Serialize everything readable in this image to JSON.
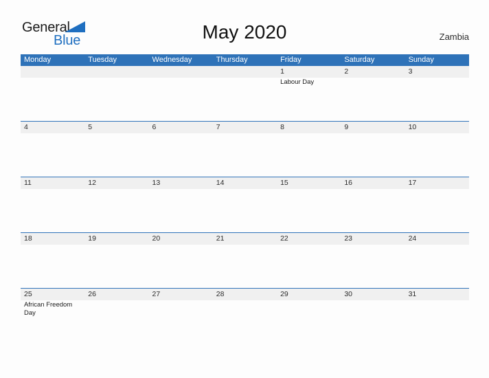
{
  "brand": {
    "name_part1": "General",
    "name_part2": "Blue",
    "accent_color": "#1f6fc0"
  },
  "header": {
    "title": "May 2020",
    "country": "Zambia"
  },
  "calendar": {
    "header_color": "#2e72b8",
    "band_color": "#f0f0f0",
    "day_names": [
      "Monday",
      "Tuesday",
      "Wednesday",
      "Thursday",
      "Friday",
      "Saturday",
      "Sunday"
    ],
    "weeks": [
      [
        {
          "day": "",
          "events": []
        },
        {
          "day": "",
          "events": []
        },
        {
          "day": "",
          "events": []
        },
        {
          "day": "",
          "events": []
        },
        {
          "day": "1",
          "events": [
            "Labour Day"
          ]
        },
        {
          "day": "2",
          "events": []
        },
        {
          "day": "3",
          "events": []
        }
      ],
      [
        {
          "day": "4",
          "events": []
        },
        {
          "day": "5",
          "events": []
        },
        {
          "day": "6",
          "events": []
        },
        {
          "day": "7",
          "events": []
        },
        {
          "day": "8",
          "events": []
        },
        {
          "day": "9",
          "events": []
        },
        {
          "day": "10",
          "events": []
        }
      ],
      [
        {
          "day": "11",
          "events": []
        },
        {
          "day": "12",
          "events": []
        },
        {
          "day": "13",
          "events": []
        },
        {
          "day": "14",
          "events": []
        },
        {
          "day": "15",
          "events": []
        },
        {
          "day": "16",
          "events": []
        },
        {
          "day": "17",
          "events": []
        }
      ],
      [
        {
          "day": "18",
          "events": []
        },
        {
          "day": "19",
          "events": []
        },
        {
          "day": "20",
          "events": []
        },
        {
          "day": "21",
          "events": []
        },
        {
          "day": "22",
          "events": []
        },
        {
          "day": "23",
          "events": []
        },
        {
          "day": "24",
          "events": []
        }
      ],
      [
        {
          "day": "25",
          "events": [
            "African Freedom Day"
          ]
        },
        {
          "day": "26",
          "events": []
        },
        {
          "day": "27",
          "events": []
        },
        {
          "day": "28",
          "events": []
        },
        {
          "day": "29",
          "events": []
        },
        {
          "day": "30",
          "events": []
        },
        {
          "day": "31",
          "events": []
        }
      ]
    ]
  }
}
